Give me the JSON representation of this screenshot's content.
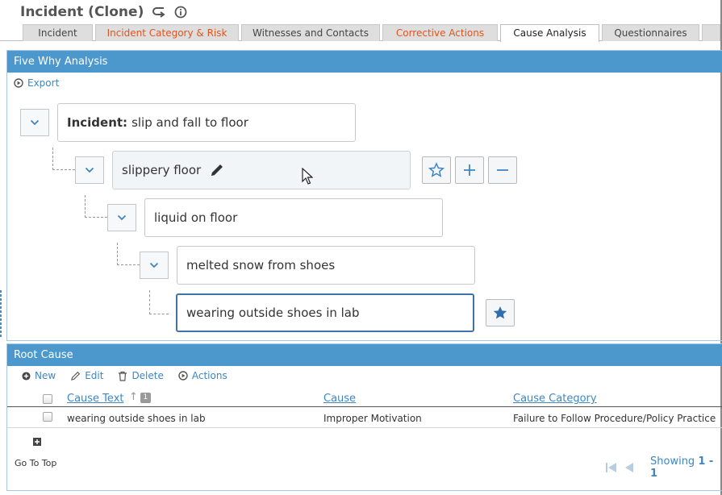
{
  "header": {
    "title": "Incident (Clone)",
    "icons": [
      "return-arrow-icon",
      "info-icon"
    ]
  },
  "tabs": [
    {
      "label": "Incident",
      "style": "normal"
    },
    {
      "label": "Incident Category & Risk",
      "style": "orange"
    },
    {
      "label": "Witnesses and Contacts",
      "style": "normal"
    },
    {
      "label": "Corrective Actions",
      "style": "orange"
    },
    {
      "label": "Cause Analysis",
      "style": "active"
    },
    {
      "label": "Questionnaires",
      "style": "normal"
    }
  ],
  "five_why": {
    "title": "Five Why Analysis",
    "export_label": "Export",
    "root": {
      "prefix": "Incident:",
      "text": "slip and fall to floor"
    },
    "whys": [
      "slippery floor",
      "liquid on floor",
      "melted snow from shoes",
      "wearing outside shoes in lab"
    ]
  },
  "root_cause": {
    "title": "Root Cause",
    "toolbar": {
      "new": "New",
      "edit": "Edit",
      "delete": "Delete",
      "actions": "Actions"
    },
    "columns": {
      "cause_text": "Cause Text",
      "sort_badge": "1",
      "cause": "Cause",
      "cause_category": "Cause Category"
    },
    "rows": [
      {
        "cause_text": "wearing outside shoes in lab",
        "cause": "Improper Motivation",
        "cause_category": "Failure to Follow Procedure/Policy Practice"
      }
    ],
    "go_to_top": "Go To Top",
    "showing_label": "Showing",
    "showing_range": "1 - 1"
  },
  "colors": {
    "accent": "#4c98cc",
    "link": "#3e86c2",
    "warn_tab": "#e0551e"
  }
}
